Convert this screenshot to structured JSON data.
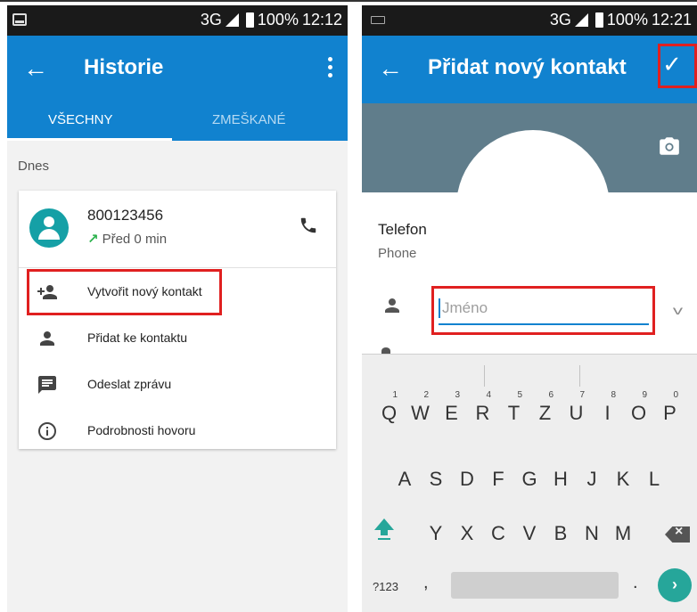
{
  "left": {
    "status": {
      "network": "3G",
      "battery": "100%",
      "time": "12:12"
    },
    "appbar": {
      "title": "Historie"
    },
    "tabs": [
      {
        "label": "VŠECHNY"
      },
      {
        "label": "ZMEŠKANÉ"
      }
    ],
    "section": "Dnes",
    "call": {
      "number": "800123456",
      "arrow": "↗",
      "time": "Před 0 min"
    },
    "actions": [
      {
        "label": "Vytvořit nový kontakt"
      },
      {
        "label": "Přidat ke kontaktu"
      },
      {
        "label": "Odeslat zprávu"
      },
      {
        "label": "Podrobnosti hovoru"
      }
    ]
  },
  "right": {
    "status": {
      "network": "3G",
      "battery": "100%",
      "time": "12:21"
    },
    "appbar": {
      "title": "Přidat nový kontakt"
    },
    "phone_field": {
      "label": "Telefon",
      "sublabel": "Phone"
    },
    "name_input": {
      "placeholder": "Jméno",
      "value": ""
    },
    "keyboard": {
      "row1": [
        {
          "key": "Q",
          "hint": "1"
        },
        {
          "key": "W",
          "hint": "2"
        },
        {
          "key": "E",
          "hint": "3"
        },
        {
          "key": "R",
          "hint": "4"
        },
        {
          "key": "T",
          "hint": "5"
        },
        {
          "key": "Z",
          "hint": "6"
        },
        {
          "key": "U",
          "hint": "7"
        },
        {
          "key": "I",
          "hint": "8"
        },
        {
          "key": "O",
          "hint": "9"
        },
        {
          "key": "P",
          "hint": "0"
        }
      ],
      "row2": [
        "A",
        "S",
        "D",
        "F",
        "G",
        "H",
        "J",
        "K",
        "L"
      ],
      "row3": [
        "Y",
        "X",
        "C",
        "V",
        "B",
        "N",
        "M"
      ],
      "symbols": "?123",
      "comma": ",",
      "period": "."
    }
  },
  "colors": {
    "primary": "#1182cf",
    "avatar": "#15a0a6",
    "highlight": "#e02020",
    "photo_bg": "#607d8b",
    "go_key": "#26a69a",
    "outgoing_arrow": "#2bb24c"
  }
}
